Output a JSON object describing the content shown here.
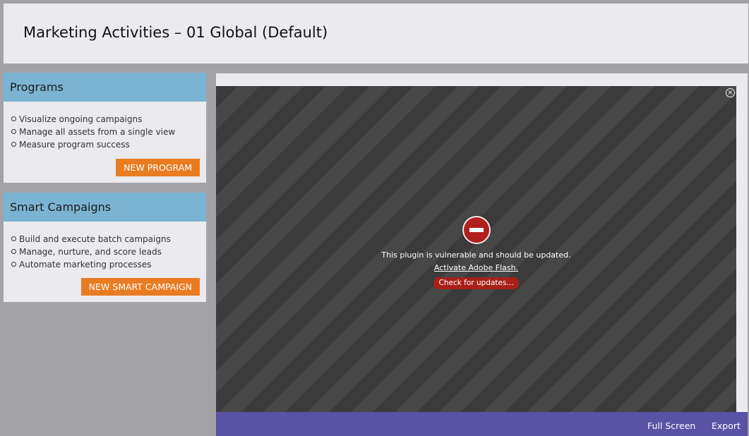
{
  "header": {
    "title": "Marketing Activities – 01 Global (Default)"
  },
  "programs": {
    "title": "Programs",
    "items": [
      "Visualize ongoing campaigns",
      "Manage all assets from a single view",
      "Measure program success"
    ],
    "button": "NEW PROGRAM"
  },
  "smart_campaigns": {
    "title": "Smart Campaigns",
    "items": [
      "Build and execute batch campaigns",
      "Manage, nurture, and score leads",
      "Automate marketing processes"
    ],
    "button": "NEW SMART CAMPAIGN"
  },
  "plugin": {
    "message": "This plugin is vulnerable and should be updated.",
    "link": "Activate Adobe Flash.",
    "update_button": "Check for updates..."
  },
  "footer": {
    "full_screen": "Full Screen",
    "export": "Export"
  },
  "colors": {
    "card_header": "#7ab4d2",
    "button": "#e97c23",
    "footer": "#5a52a5",
    "stop_icon": "#b1201d"
  },
  "icons": {
    "close": "close-circle-icon",
    "blocked": "stop-sign-icon",
    "bullet": "hollow-circle-icon"
  }
}
